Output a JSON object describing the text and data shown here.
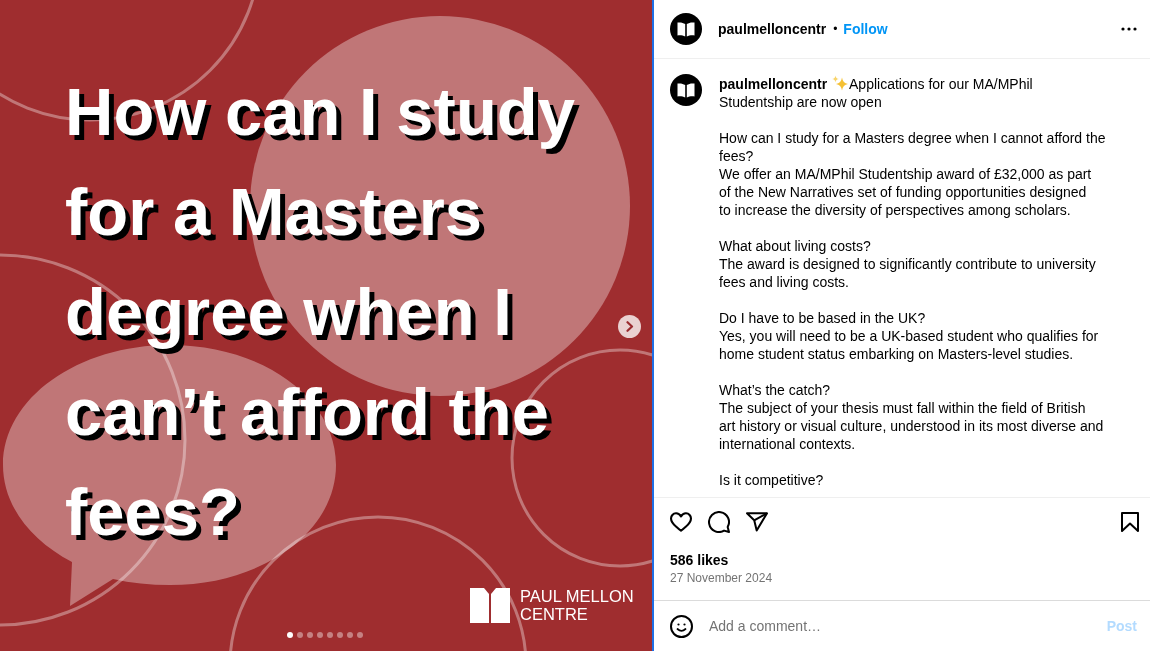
{
  "post_image": {
    "headline_lines": [
      "How can I study",
      "for a Masters",
      "degree when I",
      "can’t afford the",
      "fees?"
    ],
    "logo_lines": [
      "PAUL MELLON",
      "CENTRE"
    ],
    "dots": [
      {
        "selected": true
      },
      {
        "selected": false
      },
      {
        "selected": false
      },
      {
        "selected": false
      },
      {
        "selected": false
      },
      {
        "selected": false
      },
      {
        "selected": false
      },
      {
        "selected": false
      }
    ]
  },
  "header": {
    "username": "paulmelloncentr",
    "separator": "•",
    "follow": "Follow"
  },
  "caption": {
    "username": "paulmelloncentr",
    "sections": [
      [
        [
          "Applications for our MA/MPhil",
          "Studentship are now open"
        ]
      ],
      [
        [
          "How can I study for a Masters degree when I cannot afford the",
          "fees?"
        ],
        [
          "We offer an MA/MPhil Studentship award of £32,000 as part",
          "of the New Narratives set of funding opportunities designed",
          "to increase the diversity of perspectives among scholars."
        ]
      ],
      [
        [
          "What about living costs?"
        ],
        [
          "The award is designed to significantly contribute to university",
          "fees and living costs."
        ]
      ],
      [
        [
          "Do I have to be based in the UK?"
        ],
        [
          "Yes, you will need to be a UK-based student who qualifies for",
          "home student status embarking on Masters-level studies."
        ]
      ],
      [
        [
          "What’s the catch?"
        ],
        [
          "The subject of your thesis must fall within the field of British",
          "art history or visual culture, understood in its most diverse and",
          "international contexts."
        ]
      ],
      [
        [
          "Is it competitive?"
        ]
      ]
    ]
  },
  "actions": {
    "liked": false,
    "saved": false,
    "likes": "586 likes",
    "date": "27 November 2024"
  },
  "comment": {
    "placeholder": "Add a comment…",
    "post": "Post",
    "post_disabled": true
  }
}
